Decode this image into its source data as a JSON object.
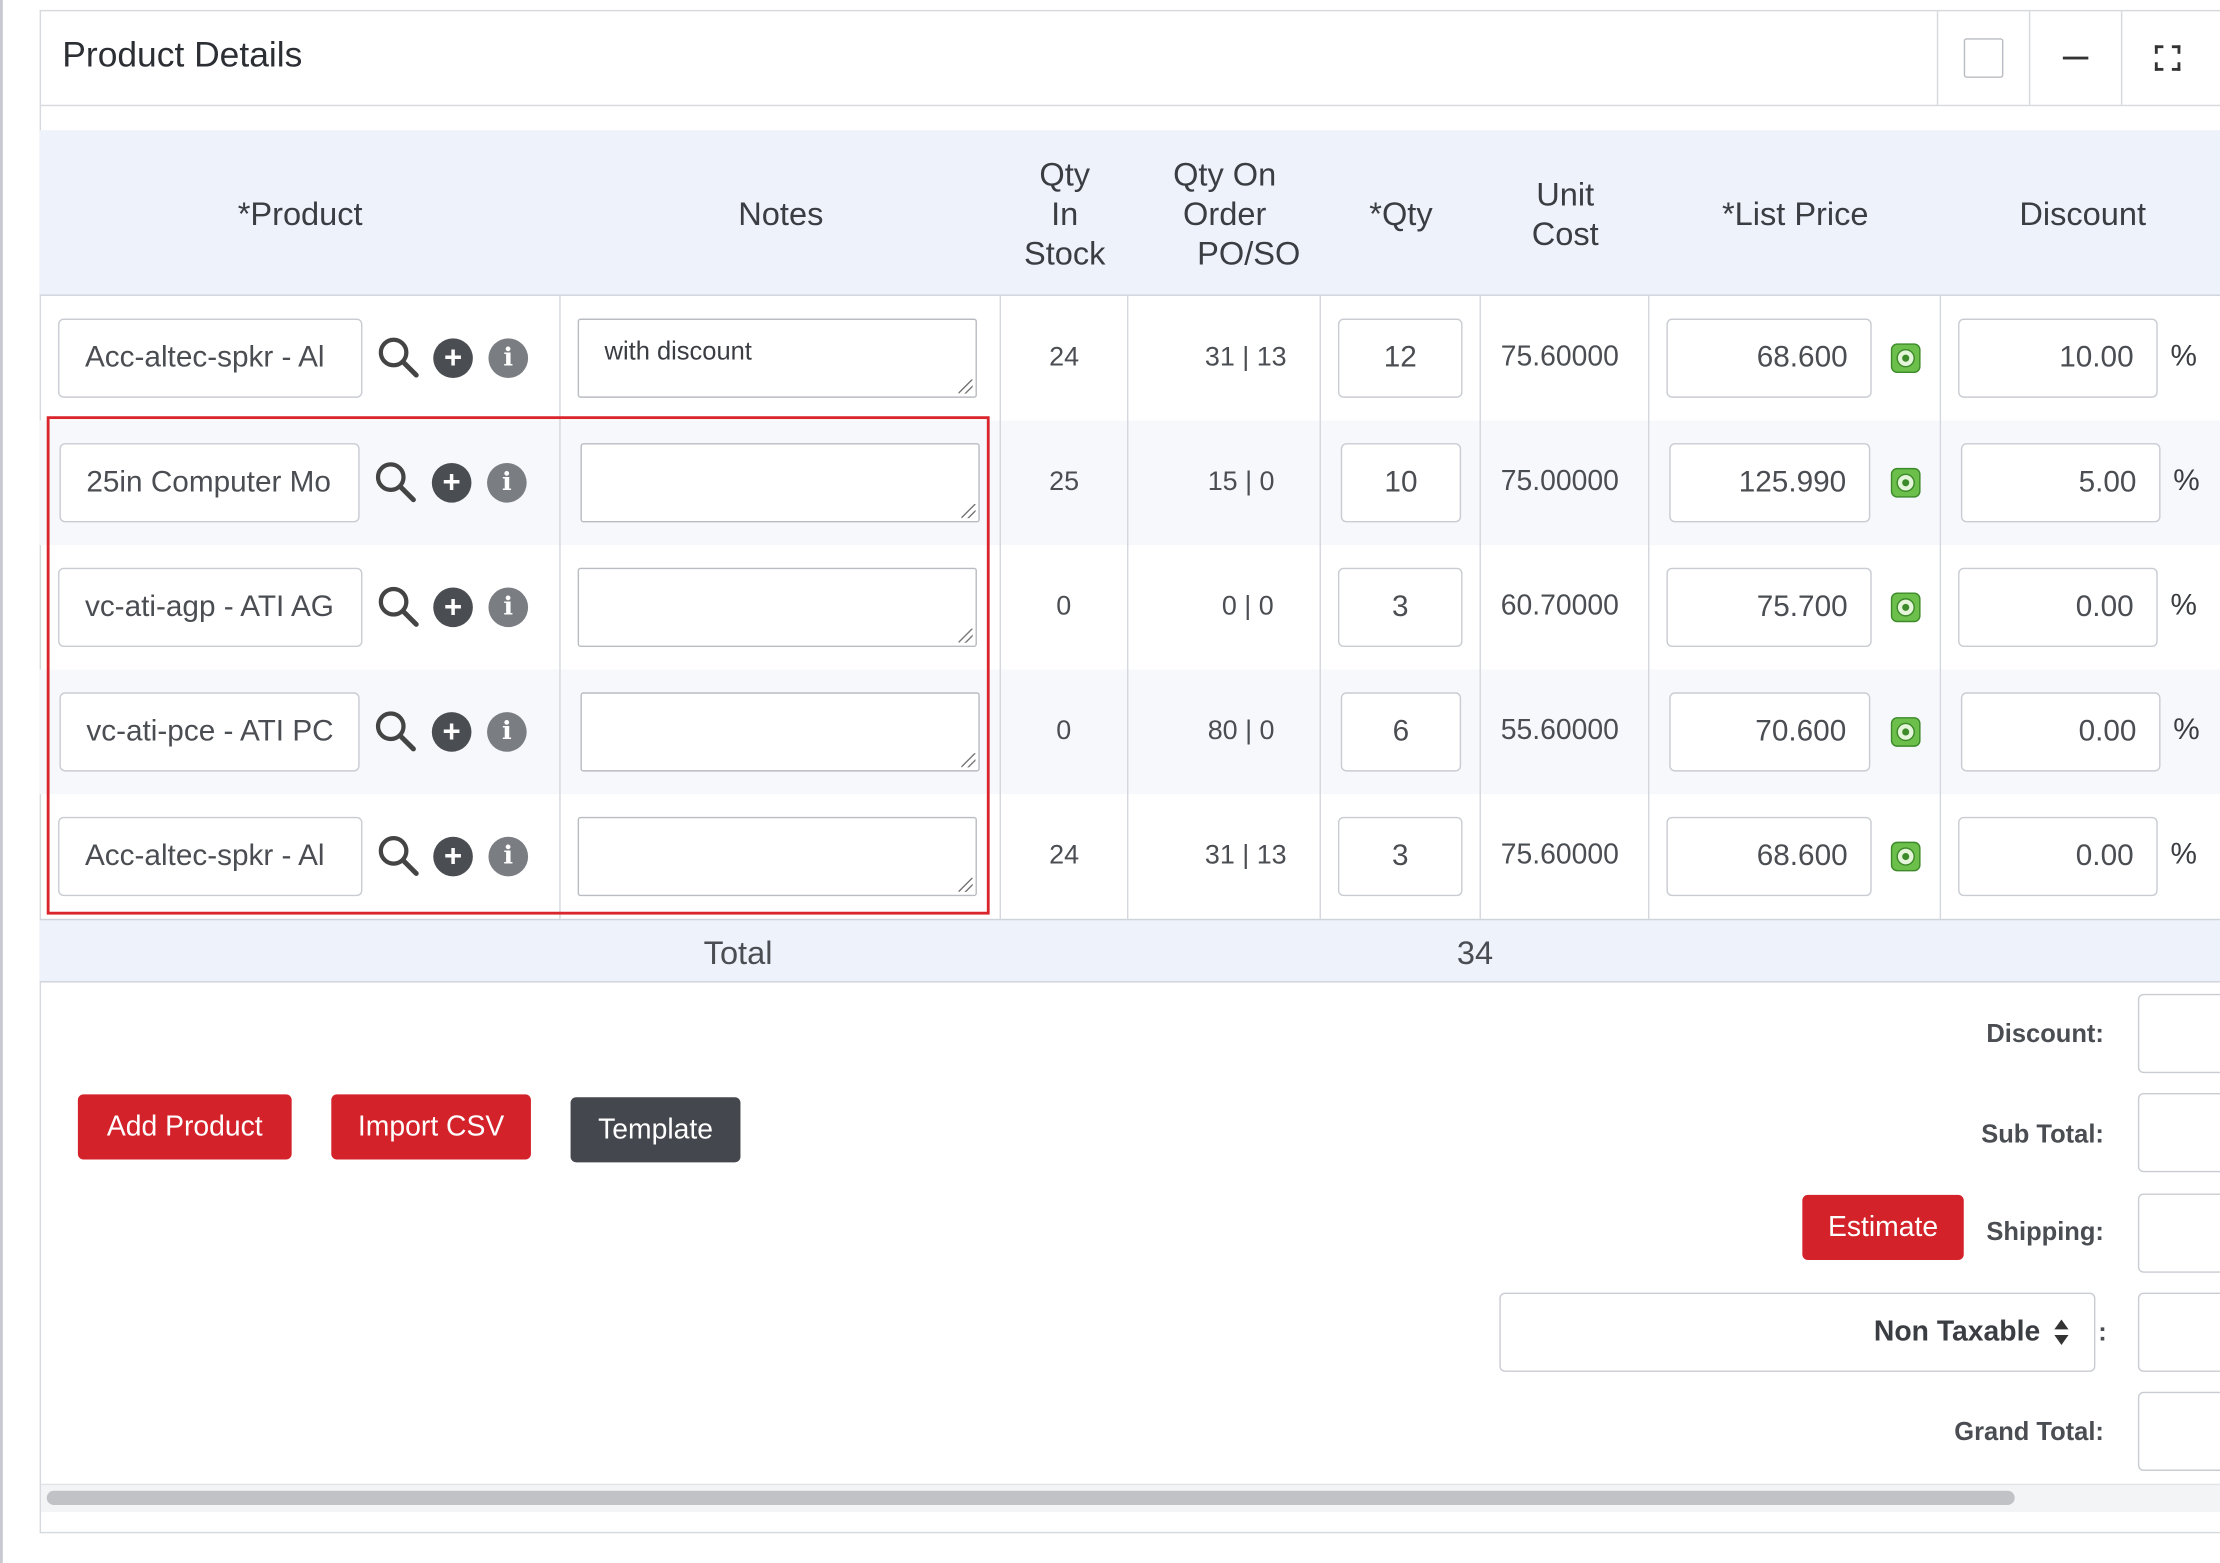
{
  "panel": {
    "title": "Product Details"
  },
  "table": {
    "headers": {
      "product": "*Product",
      "notes": "Notes",
      "qty_in_stock": [
        "Qty",
        "In",
        "Stock"
      ],
      "qty_on_order": [
        "Qty On",
        "Order",
        "PO/SO"
      ],
      "qty": "*Qty",
      "unit_cost": [
        "Unit",
        "Cost"
      ],
      "list_price": "*List Price",
      "discount": "Discount"
    },
    "rows": [
      {
        "product": "Acc-altec-spkr - Al",
        "notes": "with discount",
        "in_stock": "24",
        "on_order": "31 | 13",
        "qty": "12",
        "unit_cost": "75.60000",
        "list_price": "68.600",
        "discount": "10.00",
        "pct": "%"
      },
      {
        "product": "25in Computer Mo",
        "notes": "",
        "in_stock": "25",
        "on_order": "15 | 0",
        "qty": "10",
        "unit_cost": "75.00000",
        "list_price": "125.990",
        "discount": "5.00",
        "pct": "%"
      },
      {
        "product": "vc-ati-agp - ATI AG",
        "notes": "",
        "in_stock": "0",
        "on_order": "0 | 0",
        "qty": "3",
        "unit_cost": "60.70000",
        "list_price": "75.700",
        "discount": "0.00",
        "pct": "%"
      },
      {
        "product": "vc-ati-pce - ATI PC",
        "notes": "",
        "in_stock": "0",
        "on_order": "80 | 0",
        "qty": "6",
        "unit_cost": "55.60000",
        "list_price": "70.600",
        "discount": "0.00",
        "pct": "%"
      },
      {
        "product": "Acc-altec-spkr - Al",
        "notes": "",
        "in_stock": "24",
        "on_order": "31 | 13",
        "qty": "3",
        "unit_cost": "75.60000",
        "list_price": "68.600",
        "discount": "0.00",
        "pct": "%"
      }
    ],
    "footer": {
      "total_label": "Total",
      "total_qty": "34"
    }
  },
  "actions": {
    "add_product": "Add Product",
    "import_csv": "Import CSV",
    "template": "Template",
    "estimate": "Estimate"
  },
  "summary": {
    "discount_label": "Discount:",
    "subtotal_label": "Sub Total:",
    "shipping_label": "Shipping:",
    "tax_select": "Non Taxable",
    "tax_colon": ":",
    "grand_total_label": "Grand Total:"
  },
  "colors": {
    "accent_red": "#d4222a",
    "dark_button": "#44474d",
    "header_bg": "#eef2fb",
    "highlight_border": "#d9252b"
  }
}
